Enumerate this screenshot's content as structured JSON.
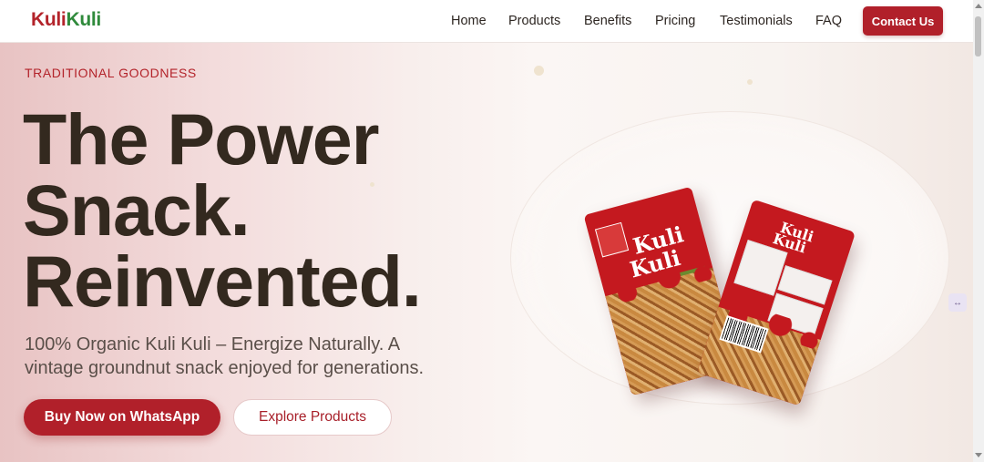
{
  "nav": {
    "brand_part1": "Kuli",
    "brand_part2": "Kuli",
    "items": [
      {
        "label": "Home"
      },
      {
        "label": "Products"
      },
      {
        "label": "Benefits"
      },
      {
        "label": "Pricing"
      },
      {
        "label": "Testimonials"
      },
      {
        "label": "FAQ"
      }
    ],
    "contact_label": "Contact Us"
  },
  "hero": {
    "eyebrow": "TRADITIONAL GOODNESS",
    "headline_lines": [
      "The Power",
      "Snack.",
      "Reinvented."
    ],
    "subtitle_lines": [
      "100% Organic Kuli Kuli – Energize Naturally. A",
      "vintage groundnut snack enjoyed for generations."
    ],
    "primary_cta": "Buy Now on WhatsApp",
    "secondary_cta": "Explore Products"
  },
  "product": {
    "pack_front_title_line1": "Kuli",
    "pack_front_title_line2": "Kuli",
    "pack_back_title_line1": "Kuli",
    "pack_back_title_line2": "Kuli"
  },
  "colors": {
    "brand_red": "#b1202a",
    "brand_green": "#2f8a3b",
    "headline": "#33291f"
  },
  "icons": {
    "side_widget": "expand-icon"
  }
}
